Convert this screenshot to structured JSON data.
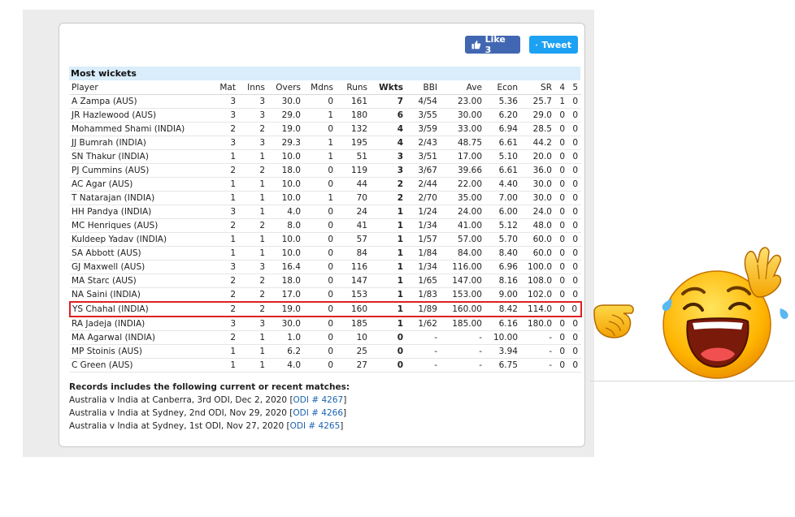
{
  "social": {
    "like_label": "Like 3",
    "tweet_label": "Tweet"
  },
  "table": {
    "title": "Most wickets",
    "headers": [
      "Player",
      "Mat",
      "Inns",
      "Overs",
      "Mdns",
      "Runs",
      "Wkts",
      "BBI",
      "Ave",
      "Econ",
      "SR",
      "4",
      "5"
    ],
    "highlight_row": 15,
    "rows": [
      [
        "A Zampa (AUS)",
        "3",
        "3",
        "30.0",
        "0",
        "161",
        "7",
        "4/54",
        "23.00",
        "5.36",
        "25.7",
        "1",
        "0"
      ],
      [
        "JR Hazlewood (AUS)",
        "3",
        "3",
        "29.0",
        "1",
        "180",
        "6",
        "3/55",
        "30.00",
        "6.20",
        "29.0",
        "0",
        "0"
      ],
      [
        "Mohammed Shami (INDIA)",
        "2",
        "2",
        "19.0",
        "0",
        "132",
        "4",
        "3/59",
        "33.00",
        "6.94",
        "28.5",
        "0",
        "0"
      ],
      [
        "JJ Bumrah (INDIA)",
        "3",
        "3",
        "29.3",
        "1",
        "195",
        "4",
        "2/43",
        "48.75",
        "6.61",
        "44.2",
        "0",
        "0"
      ],
      [
        "SN Thakur (INDIA)",
        "1",
        "1",
        "10.0",
        "1",
        "51",
        "3",
        "3/51",
        "17.00",
        "5.10",
        "20.0",
        "0",
        "0"
      ],
      [
        "PJ Cummins (AUS)",
        "2",
        "2",
        "18.0",
        "0",
        "119",
        "3",
        "3/67",
        "39.66",
        "6.61",
        "36.0",
        "0",
        "0"
      ],
      [
        "AC Agar (AUS)",
        "1",
        "1",
        "10.0",
        "0",
        "44",
        "2",
        "2/44",
        "22.00",
        "4.40",
        "30.0",
        "0",
        "0"
      ],
      [
        "T Natarajan (INDIA)",
        "1",
        "1",
        "10.0",
        "1",
        "70",
        "2",
        "2/70",
        "35.00",
        "7.00",
        "30.0",
        "0",
        "0"
      ],
      [
        "HH Pandya (INDIA)",
        "3",
        "1",
        "4.0",
        "0",
        "24",
        "1",
        "1/24",
        "24.00",
        "6.00",
        "24.0",
        "0",
        "0"
      ],
      [
        "MC Henriques (AUS)",
        "2",
        "2",
        "8.0",
        "0",
        "41",
        "1",
        "1/34",
        "41.00",
        "5.12",
        "48.0",
        "0",
        "0"
      ],
      [
        "Kuldeep Yadav (INDIA)",
        "1",
        "1",
        "10.0",
        "0",
        "57",
        "1",
        "1/57",
        "57.00",
        "5.70",
        "60.0",
        "0",
        "0"
      ],
      [
        "SA Abbott (AUS)",
        "1",
        "1",
        "10.0",
        "0",
        "84",
        "1",
        "1/84",
        "84.00",
        "8.40",
        "60.0",
        "0",
        "0"
      ],
      [
        "GJ Maxwell (AUS)",
        "3",
        "3",
        "16.4",
        "0",
        "116",
        "1",
        "1/34",
        "116.00",
        "6.96",
        "100.0",
        "0",
        "0"
      ],
      [
        "MA Starc (AUS)",
        "2",
        "2",
        "18.0",
        "0",
        "147",
        "1",
        "1/65",
        "147.00",
        "8.16",
        "108.0",
        "0",
        "0"
      ],
      [
        "NA Saini (INDIA)",
        "2",
        "2",
        "17.0",
        "0",
        "153",
        "1",
        "1/83",
        "153.00",
        "9.00",
        "102.0",
        "0",
        "0"
      ],
      [
        "YS Chahal (INDIA)",
        "2",
        "2",
        "19.0",
        "0",
        "160",
        "1",
        "1/89",
        "160.00",
        "8.42",
        "114.0",
        "0",
        "0"
      ],
      [
        "RA Jadeja (INDIA)",
        "3",
        "3",
        "30.0",
        "0",
        "185",
        "1",
        "1/62",
        "185.00",
        "6.16",
        "180.0",
        "0",
        "0"
      ],
      [
        "MA Agarwal (INDIA)",
        "2",
        "1",
        "1.0",
        "0",
        "10",
        "0",
        "-",
        "-",
        "10.00",
        "-",
        "0",
        "0"
      ],
      [
        "MP Stoinis (AUS)",
        "1",
        "1",
        "6.2",
        "0",
        "25",
        "0",
        "-",
        "-",
        "3.94",
        "-",
        "0",
        "0"
      ],
      [
        "C Green (AUS)",
        "1",
        "1",
        "4.0",
        "0",
        "27",
        "0",
        "-",
        "-",
        "6.75",
        "-",
        "0",
        "0"
      ]
    ]
  },
  "records": {
    "title": "Records includes the following current or recent matches:",
    "matches": [
      {
        "text": "Australia v India at Canberra, 3rd ODI, Dec 2, 2020",
        "link": "ODI # 4267"
      },
      {
        "text": "Australia v India at Sydney, 2nd ODI, Nov 29, 2020",
        "link": "ODI # 4266"
      },
      {
        "text": "Australia v India at Sydney, 1st ODI, Nov 27, 2020",
        "link": "ODI # 4265"
      }
    ]
  },
  "colors": {
    "like": "#4267b2",
    "tweet": "#1da1f2",
    "title_bg": "#d9edfb",
    "highlight": "#e02020",
    "link": "#1a62b0"
  },
  "icons": [
    "thumbs-up-icon",
    "twitter-bird-icon",
    "pointing-hand-emoji-icon",
    "laughing-face-emoji-icon"
  ]
}
